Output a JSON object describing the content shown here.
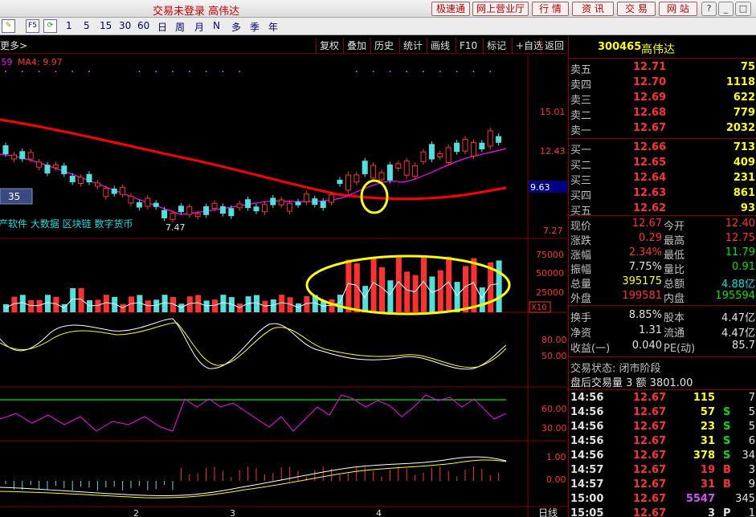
{
  "titlebar": {
    "title": "交易未登录  高伟达",
    "buttons": [
      "极速通",
      "网上营业厅",
      "行 情",
      "资 讯",
      "交 易",
      "网 站"
    ],
    "window_buttons": [
      "?",
      "_",
      "□",
      "×"
    ]
  },
  "toolbar": {
    "icons": [
      "pencil-icon",
      "f5-icon",
      "refresh-icon"
    ],
    "f5_label": "F5",
    "periods": [
      "1",
      "5",
      "15",
      "30",
      "60"
    ],
    "ranges": [
      "日",
      "周",
      "月",
      "N",
      "多",
      "季",
      "年"
    ]
  },
  "chartbar": {
    "left_label": "更多>",
    "buttons": [
      "复权",
      "叠加",
      "历史",
      "统计",
      "画线",
      "F10",
      "标记",
      "+自选",
      "返回"
    ]
  },
  "chart": {
    "ma_legend_left": ".59",
    "ma4_label": "MA4: 9.97",
    "price_ticks": [
      "15.01",
      "12.43",
      "9.63",
      "7.27"
    ],
    "low_marker": "7.47",
    "concepts": "产软件 大数据 区块链 数字货币",
    "left_box": "35",
    "volume_ticks": [
      "75000",
      "50000",
      "25000"
    ],
    "volume_unit": "X10",
    "kdj_ticks": [
      "80.00",
      "50.00"
    ],
    "rsi_ticks": [
      "60.00",
      "30.00"
    ],
    "macd_ticks": [
      "1.00",
      "0.00"
    ],
    "x_labels": [
      "2",
      "3",
      "4"
    ],
    "period_label": "日线",
    "colors": {
      "up": "#ff3030",
      "down": "#50e0e0",
      "ma_red": "#ff0000",
      "ma_purple": "#ff00ff",
      "highlight": "#ffff00"
    }
  },
  "quote": {
    "code": "300465",
    "name": "高伟达",
    "asks": [
      {
        "label": "卖五",
        "price": "12.71",
        "vol": "75"
      },
      {
        "label": "卖四",
        "price": "12.70",
        "vol": "1118"
      },
      {
        "label": "卖三",
        "price": "12.69",
        "vol": "622"
      },
      {
        "label": "卖二",
        "price": "12.68",
        "vol": "779"
      },
      {
        "label": "卖一",
        "price": "12.67",
        "vol": "2032"
      }
    ],
    "bids": [
      {
        "label": "买一",
        "price": "12.66",
        "vol": "713"
      },
      {
        "label": "买二",
        "price": "12.65",
        "vol": "409"
      },
      {
        "label": "买三",
        "price": "12.64",
        "vol": "231"
      },
      {
        "label": "买四",
        "price": "12.63",
        "vol": "861"
      },
      {
        "label": "买五",
        "price": "12.62",
        "vol": "93"
      }
    ],
    "stats": [
      {
        "l1": "现价",
        "v1": "12.67",
        "c1": "red",
        "l2": "今开",
        "v2": "12.40",
        "c2": "red"
      },
      {
        "l1": "涨跌",
        "v1": "0.29",
        "c1": "red",
        "l2": "最高",
        "v2": "12.75",
        "c2": "red"
      },
      {
        "l1": "涨幅",
        "v1": "2.34%",
        "c1": "red",
        "l2": "最低",
        "v2": "11.79",
        "c2": "green"
      },
      {
        "l1": "振幅",
        "v1": "7.75%",
        "c1": "white",
        "l2": "量比",
        "v2": "0.91",
        "c2": "green"
      },
      {
        "l1": "总量",
        "v1": "395175",
        "c1": "yellow",
        "l2": "总额",
        "v2": "4.88亿",
        "c2": "cyan"
      },
      {
        "l1": "外盘",
        "v1": "199581",
        "c1": "red",
        "l2": "内盘",
        "v2": "195594",
        "c2": "green"
      }
    ],
    "stats2": [
      {
        "l1": "换手",
        "v1": "8.85%",
        "l2": "股本",
        "v2": "4.47亿"
      },
      {
        "l1": "净资",
        "v1": "1.31",
        "l2": "流通",
        "v2": "4.47亿"
      },
      {
        "l1": "收益(一)",
        "v1": "0.040",
        "l2": "PE(动)",
        "v2": "85.7"
      }
    ],
    "trade_status": "交易状态: 闭市阶段",
    "after_hours": "盘后交易量 3 额 3801.00",
    "ticks": [
      {
        "time": "14:56",
        "price": "12.67",
        "vol": "115",
        "side": "",
        "n": "7",
        "vc": "yellow"
      },
      {
        "time": "14:56",
        "price": "12.67",
        "vol": "57",
        "side": "S",
        "n": "5",
        "vc": "yellow"
      },
      {
        "time": "14:56",
        "price": "12.67",
        "vol": "23",
        "side": "S",
        "n": "5",
        "vc": "yellow"
      },
      {
        "time": "14:56",
        "price": "12.67",
        "vol": "31",
        "side": "S",
        "n": "6",
        "vc": "yellow"
      },
      {
        "time": "14:56",
        "price": "12.67",
        "vol": "378",
        "side": "S",
        "n": "34",
        "vc": "yellow"
      },
      {
        "time": "14:57",
        "price": "12.67",
        "vol": "19",
        "side": "B",
        "n": "3",
        "vc": "red"
      },
      {
        "time": "14:57",
        "price": "12.67",
        "vol": "31",
        "side": "B",
        "n": "9",
        "vc": "red"
      },
      {
        "time": "15:00",
        "price": "12.67",
        "vol": "5547",
        "side": "",
        "n": "345",
        "vc": "purple"
      },
      {
        "time": "15:05",
        "price": "12.67",
        "vol": "3",
        "side": "P",
        "n": "1",
        "vc": "white"
      }
    ]
  }
}
